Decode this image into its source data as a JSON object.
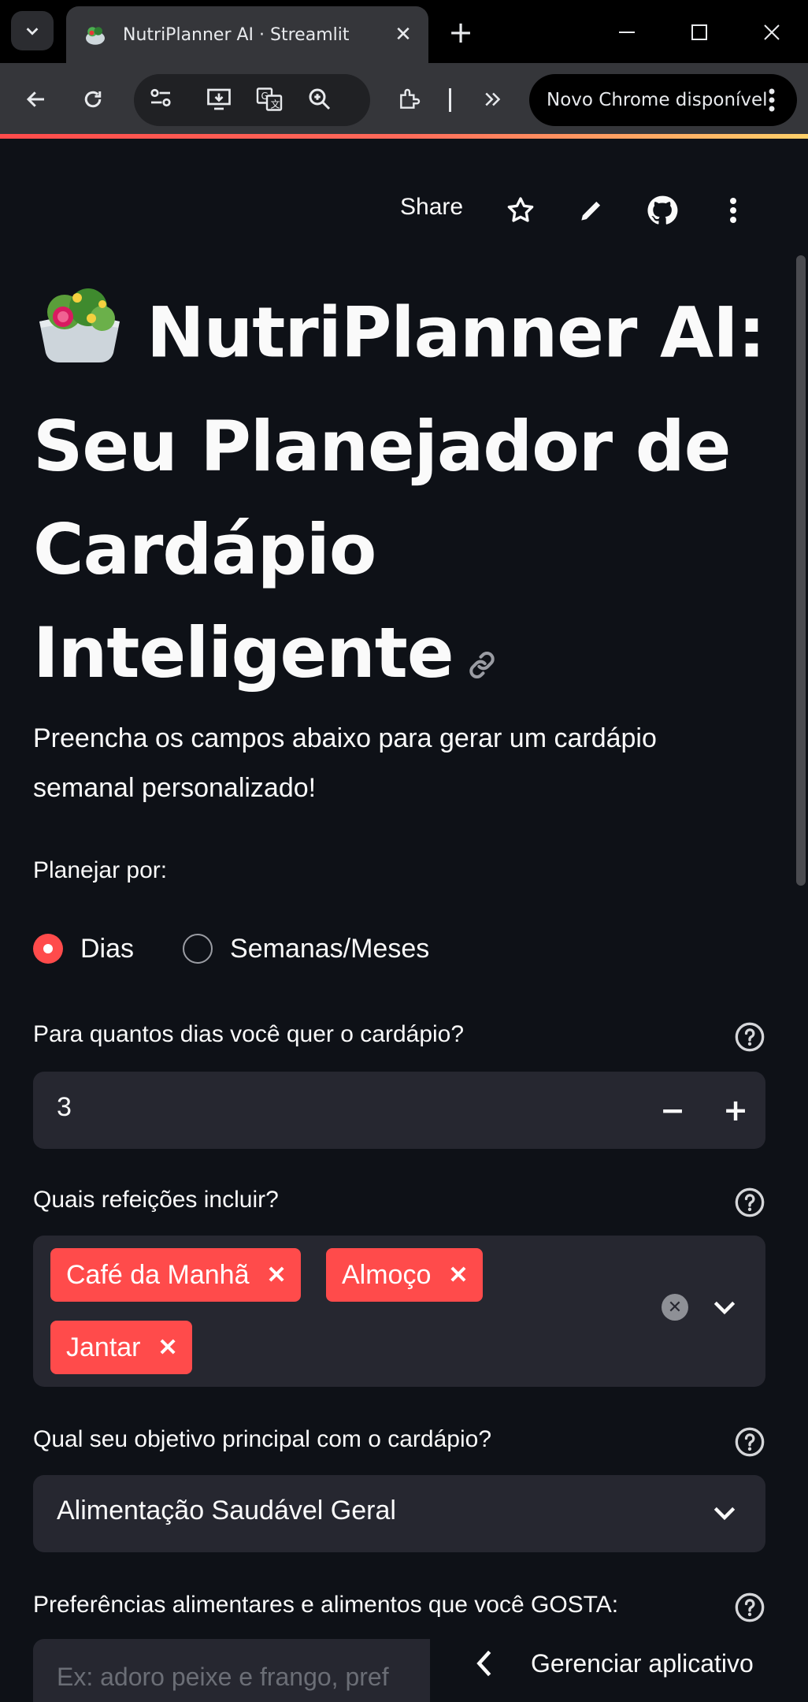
{
  "browser": {
    "tab_title": "NutriPlanner AI · Streamlit",
    "tab_favicon": "salad-icon",
    "new_chrome_label": "Novo Chrome disponível"
  },
  "header": {
    "share_label": "Share",
    "icons": [
      "star-icon",
      "pencil-icon",
      "github-icon",
      "more-vertical-icon"
    ]
  },
  "page": {
    "title": "NutriPlanner AI: Seu Planejador de Cardápio Inteligente",
    "title_emoji": "salad-bowl-icon",
    "subtitle": "Preencha os campos abaixo para gerar um cardápio semanal personalizado!"
  },
  "plan_by": {
    "label": "Planejar por:",
    "options": [
      "Dias",
      "Semanas/Meses"
    ],
    "selected": "Dias"
  },
  "days": {
    "label": "Para quantos dias você quer o cardápio?",
    "value": "3",
    "minus": "−",
    "plus": "+"
  },
  "meals": {
    "label": "Quais refeições incluir?",
    "selected": [
      "Café da Manhã",
      "Almoço",
      "Jantar"
    ]
  },
  "goal": {
    "label": "Qual seu objetivo principal com o cardápio?",
    "value": "Alimentação Saudável Geral"
  },
  "likes": {
    "label": "Preferências alimentares e alimentos que você GOSTA:",
    "placeholder": "Ex: adoro peixe e frango, pref"
  },
  "manage_app": {
    "label": "Gerenciar aplicativo"
  },
  "colors": {
    "primary": "#ff4b4b",
    "background": "#0e1117",
    "widget_bg": "#262730"
  }
}
